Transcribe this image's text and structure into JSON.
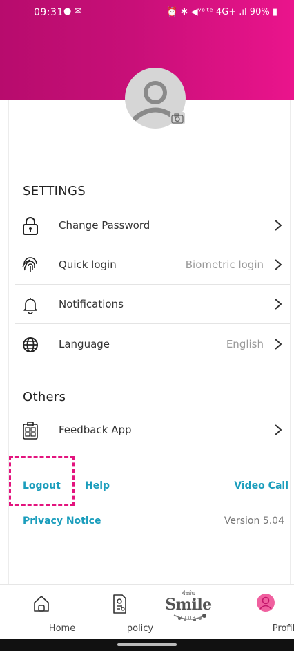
{
  "status_bar": {
    "time": "09:31",
    "left_icons": "● ✉",
    "right_icons": "⏰ ✱ ◀ᵛᵒˡᵗᵉ 4G+ .ıl",
    "battery": "90%"
  },
  "profile": {
    "avatar_icon": "user-icon",
    "camera_icon": "camera-icon"
  },
  "settings": {
    "title": "SETTINGS",
    "items": [
      {
        "label": "Change Password",
        "value": "",
        "icon": "lock-icon"
      },
      {
        "label": "Quick login",
        "value": "Biometric login",
        "icon": "fingerprint-icon"
      },
      {
        "label": "Notifications",
        "value": "",
        "icon": "bell-icon"
      },
      {
        "label": "Language",
        "value": "English",
        "icon": "globe-icon"
      }
    ]
  },
  "others": {
    "title": "Others",
    "items": [
      {
        "label": "Feedback App",
        "value": "",
        "icon": "clipboard-icon"
      }
    ]
  },
  "links": {
    "logout": "Logout",
    "help": "Help",
    "video_call": "Video Call",
    "privacy": "Privacy Notice",
    "version": "Version 5.04"
  },
  "bottom_nav": {
    "home": "Home",
    "policy": "policy",
    "brand_top": "ซื่อมั่น",
    "brand": "Smile",
    "brand_sub": "CLUB",
    "profile": "Profile"
  },
  "colors": {
    "header_start": "#b70c6d",
    "header_end": "#ea148c",
    "link": "#1a9dbc",
    "highlight": "#e3147e",
    "profile_active": "#f0609f"
  }
}
